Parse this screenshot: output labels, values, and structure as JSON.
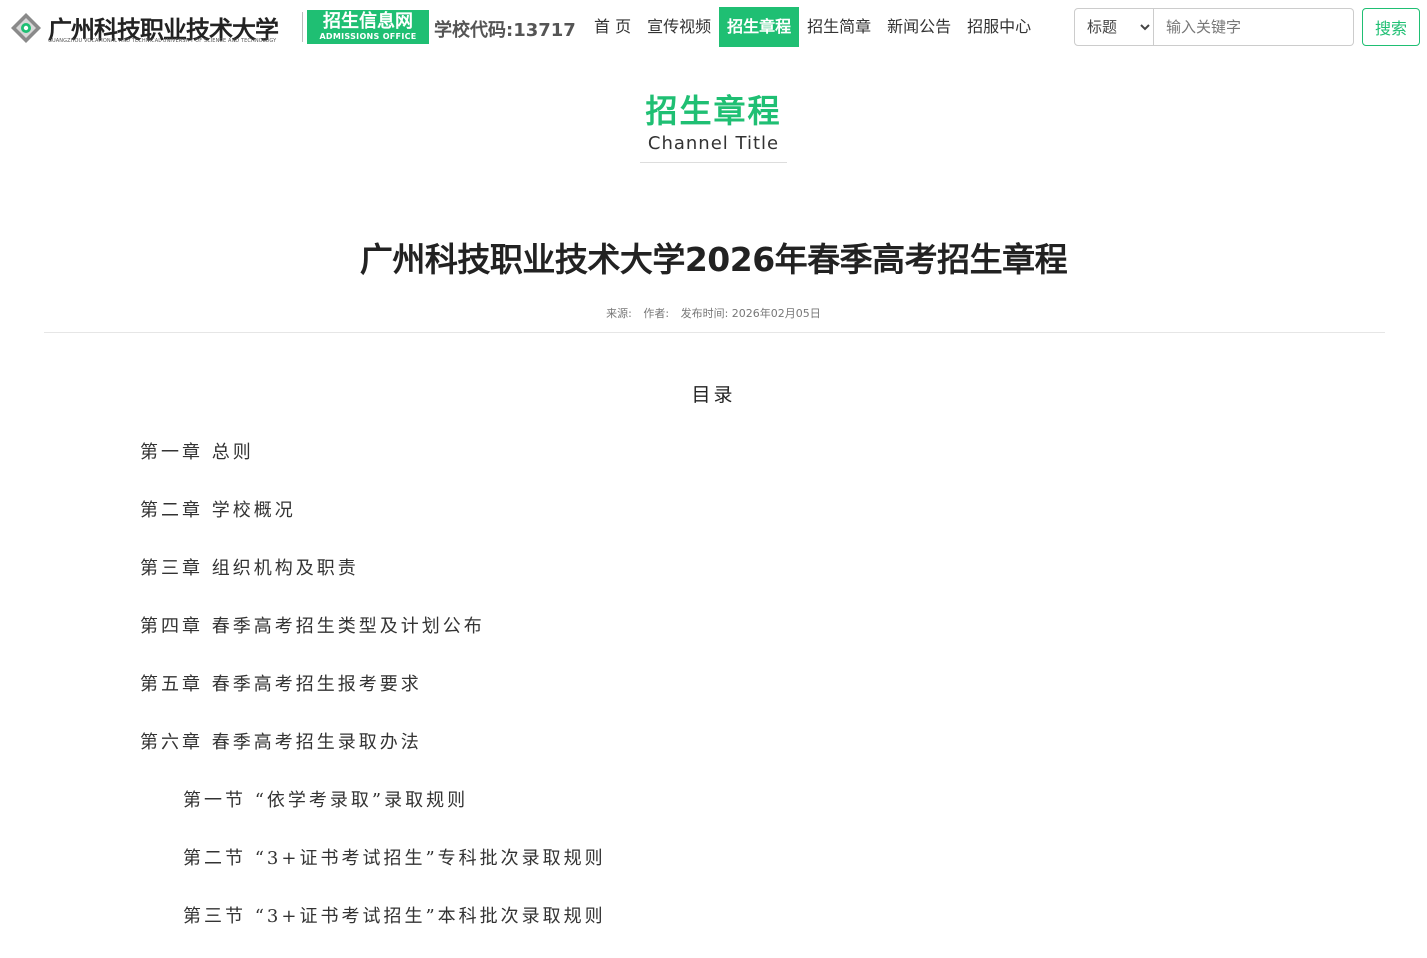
{
  "header": {
    "logo_name": "广州科技职业技术大学",
    "logo_en": "GUANGZHOU VOCATIONAL AND TECHNICAL UNIVERSITY OF SCIENCE AND TECHNOLOGY",
    "badge_cn": "招生信息网",
    "badge_en": "ADMISSIONS OFFICE",
    "school_code": "学校代码:13717",
    "accent_color": "#1fbf73"
  },
  "nav": {
    "items": [
      "首  页",
      "宣传视频",
      "招生章程",
      "招生简章",
      "新闻公告",
      "招服中心"
    ],
    "active": "招生章程"
  },
  "search": {
    "select_value": "标题",
    "placeholder": "输入关键字",
    "button_label": "搜索"
  },
  "channel": {
    "title_cn": "招生章程",
    "title_en": "Channel Title"
  },
  "article": {
    "title": "广州科技职业技术大学2026年春季高考招生章程",
    "meta_source": "来源:",
    "meta_author": "作者:",
    "meta_date": "发布时间:  2026年02月05日"
  },
  "toc": {
    "heading": "目录",
    "items": [
      "第一章  总则",
      "第二章  学校概况",
      "第三章  组织机构及职责",
      "第四章  春季高考招生类型及计划公布",
      "第五章  春季高考招生报考要求",
      "第六章  春季高考招生录取办法",
      "第一节  “依学考录取”录取规则",
      "第二节  “3+证书考试招生”专科批次录取规则",
      "第三节  “3+证书考试招生”本科批次录取规则"
    ]
  }
}
